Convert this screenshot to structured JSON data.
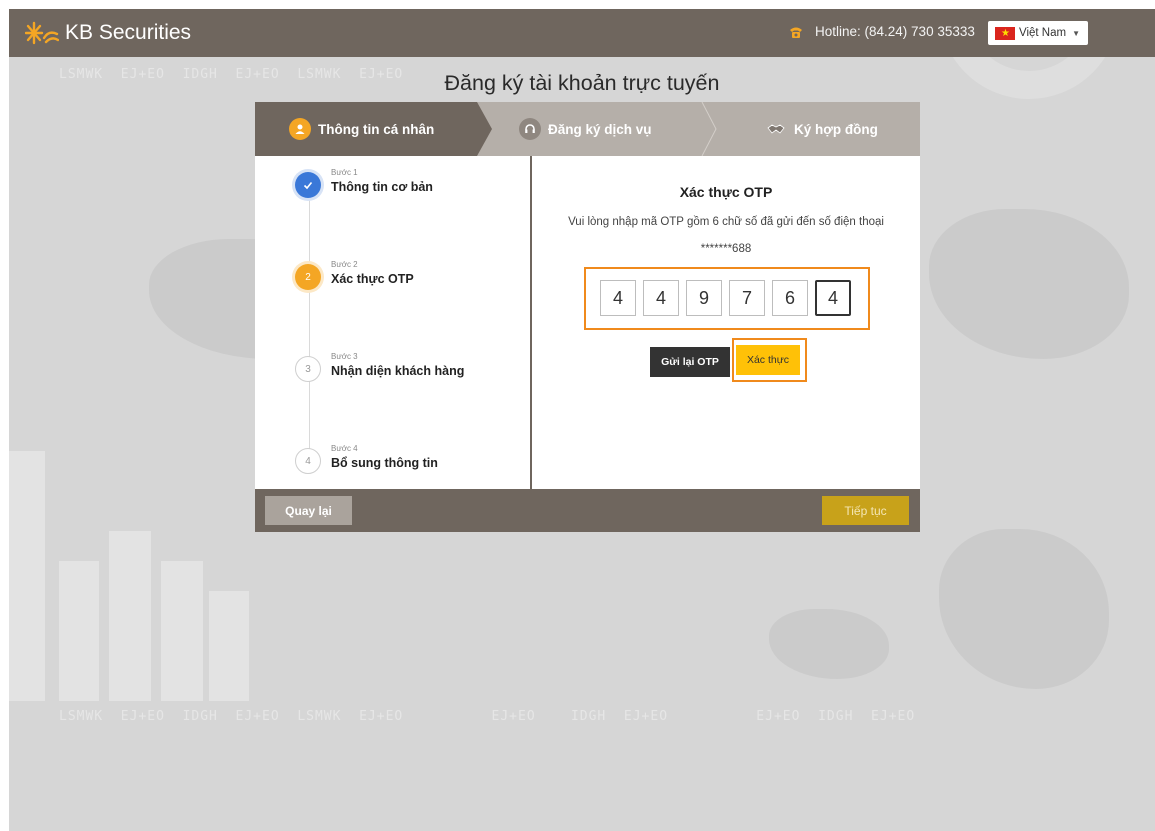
{
  "header": {
    "brand": "KB Securities",
    "hotline": "Hotline: (84.24) 730 35333",
    "language": "Việt Nam"
  },
  "page": {
    "title": "Đăng ký tài khoản trực tuyến"
  },
  "stepbar": {
    "tabs": [
      {
        "label": "Thông tin cá nhân",
        "active": true
      },
      {
        "label": "Đăng ký dịch vụ",
        "active": false
      },
      {
        "label": "Ký hợp đồng",
        "active": false
      }
    ]
  },
  "steps": [
    {
      "sub": "Bước 1",
      "title": "Thông tin cơ bản",
      "status": "done"
    },
    {
      "sub": "Bước 2",
      "number": "2",
      "title": "Xác thực OTP",
      "status": "current"
    },
    {
      "sub": "Bước 3",
      "number": "3",
      "title": "Nhận diện khách hàng",
      "status": "todo"
    },
    {
      "sub": "Bước 4",
      "number": "4",
      "title": "Bổ sung thông tin",
      "status": "todo"
    }
  ],
  "otp": {
    "title": "Xác thực OTP",
    "message": "Vui lòng nhập mã OTP gồm 6 chữ số đã gửi đến số điện thoại",
    "phone": "*******688",
    "digits": [
      "4",
      "4",
      "9",
      "7",
      "6",
      "4"
    ],
    "resend_label": "Gửi lại OTP",
    "verify_label": "Xác thực"
  },
  "footer": {
    "back_label": "Quay lại",
    "next_label": "Tiếp tục"
  },
  "colors": {
    "header_bg": "#6f665e",
    "accent_orange": "#f08a1c",
    "verify_yellow": "#ffc107",
    "step_done": "#3a78d8",
    "step_current": "#f4a624"
  }
}
